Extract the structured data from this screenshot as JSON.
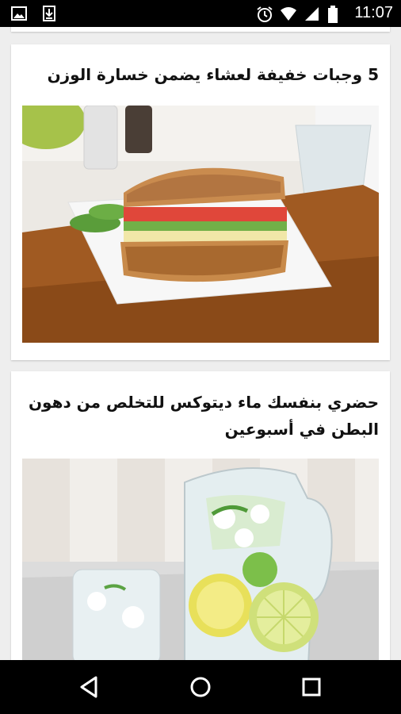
{
  "status_bar": {
    "time": "11:07",
    "left_icons": [
      "image-notification-icon",
      "download-notification-icon"
    ],
    "right_icons": [
      "alarm-icon",
      "wifi-icon",
      "cell-signal-icon",
      "battery-icon"
    ]
  },
  "feed": {
    "articles": [
      {
        "title": "5 وجبات خفيفة لعشاء يضمن خسارة الوزن",
        "image": "sandwich-photo"
      },
      {
        "title": "حضري بنفسك ماء ديتوكس للتخلص من دهون البطن في أسبوعين",
        "image": "detox-water-photo"
      }
    ]
  },
  "nav_bar": {
    "buttons": [
      "back",
      "home",
      "recents"
    ]
  },
  "colors": {
    "background": "#eeeeee",
    "card": "#ffffff",
    "bars": "#000000"
  }
}
